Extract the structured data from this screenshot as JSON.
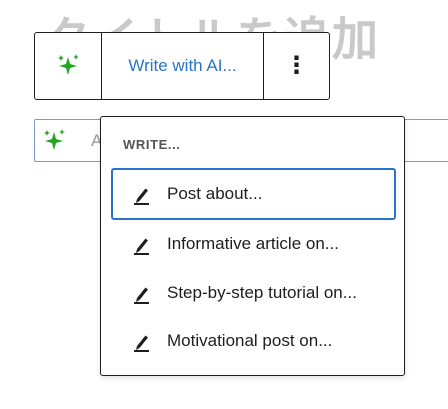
{
  "page": {
    "title": "タイトルを追加"
  },
  "toolbar": {
    "ai_icon": "sparkles-icon",
    "write_label": "Write with AI...",
    "more_icon": "more-vertical-icon",
    "more_label": "⋮"
  },
  "prompt": {
    "ai_icon": "sparkles-icon",
    "placeholder": "A"
  },
  "menu": {
    "heading": "WRITE...",
    "items": [
      {
        "label": "Post about...",
        "icon": "pencil-icon",
        "focused": true
      },
      {
        "label": "Informative article on...",
        "icon": "pencil-icon",
        "focused": false
      },
      {
        "label": "Step-by-step tutorial on...",
        "icon": "pencil-icon",
        "focused": false
      },
      {
        "label": "Motivational post on...",
        "icon": "pencil-icon",
        "focused": false
      }
    ]
  },
  "colors": {
    "accent": "#2b73c9",
    "sparkle": "#1fa51f",
    "border": "#1e1e1e",
    "title_faded": "#c9c9c9"
  }
}
